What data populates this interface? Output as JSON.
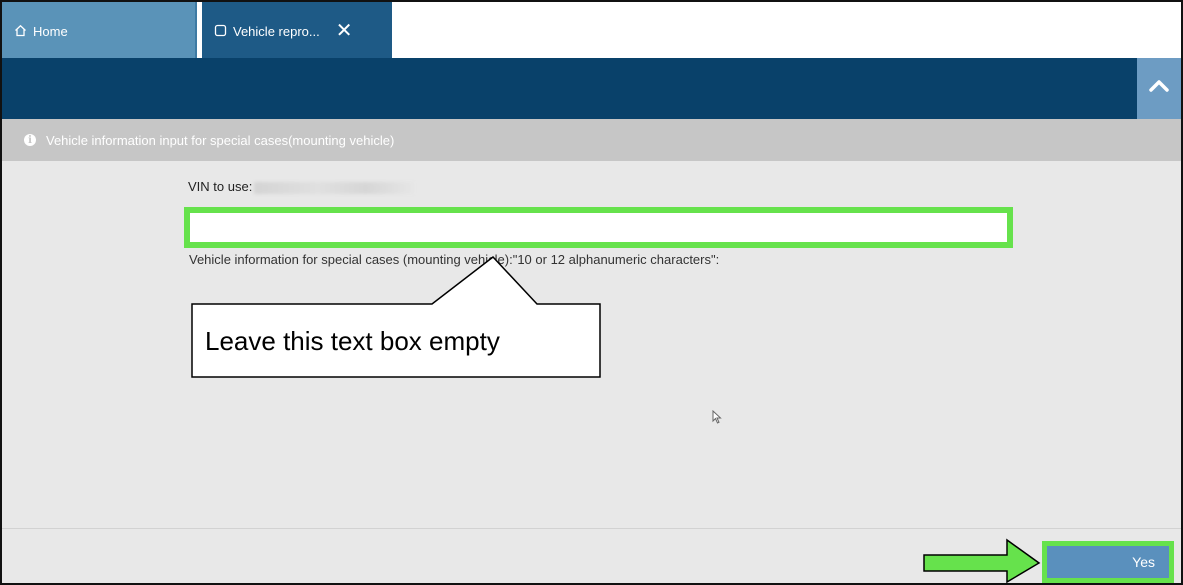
{
  "tabs": [
    {
      "label": "Home",
      "icon": "home-icon"
    },
    {
      "label": "Vehicle repro...",
      "icon": "window-icon",
      "close_icon": "close-icon"
    }
  ],
  "header": {
    "collapse_icon": "chevron-up-icon"
  },
  "info_bar": {
    "icon": "info-icon",
    "text": "Vehicle information input for special cases(mounting vehicle)"
  },
  "form": {
    "vin_label": "VIN to use:",
    "input_value": "",
    "hint": "Vehicle information for special cases (mounting vehicle):\"10 or 12 alphanumeric characters\":"
  },
  "callout": {
    "text": "Leave this text box empty"
  },
  "footer": {
    "yes_label": "Yes"
  },
  "colors": {
    "highlight": "#66e24c",
    "header": "#09416a",
    "button": "#5a90bd"
  }
}
